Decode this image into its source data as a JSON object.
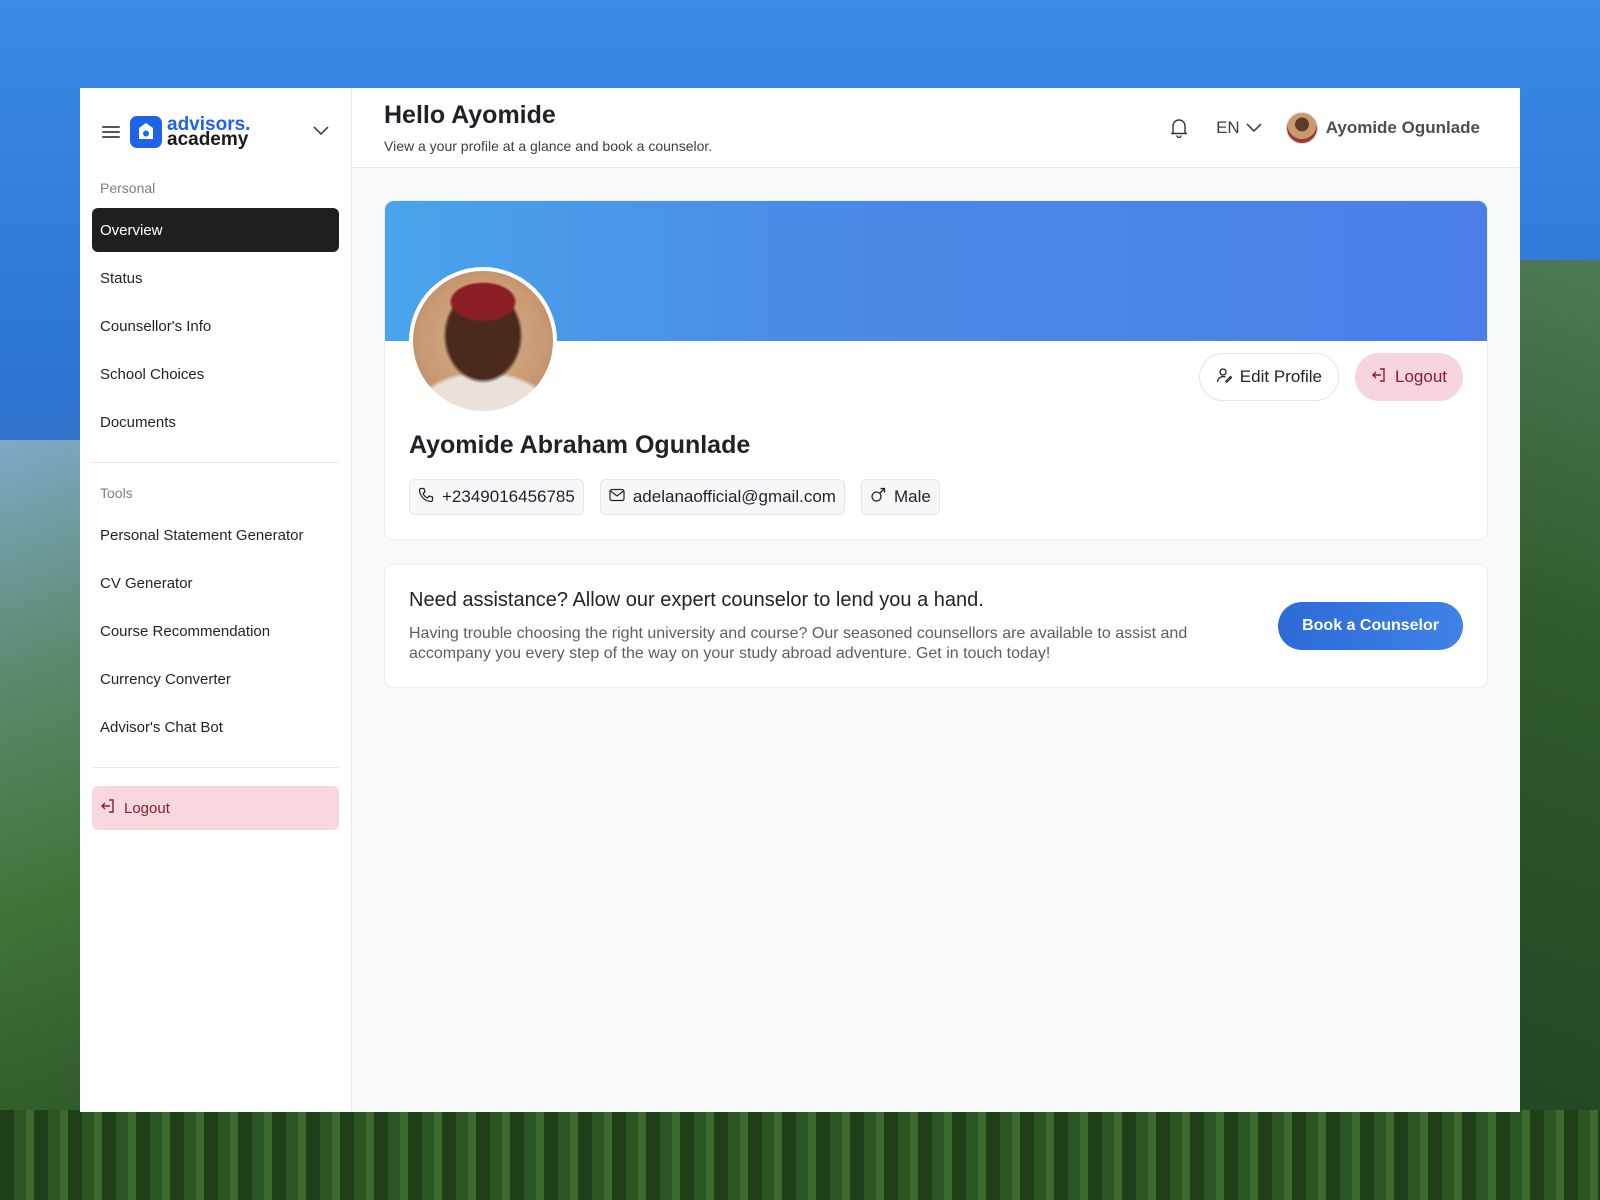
{
  "brand": {
    "name_top": "advisors.",
    "name_bottom": "academy"
  },
  "sidebar": {
    "personal_label": "Personal",
    "personal_items": [
      {
        "label": "Overview",
        "active": true
      },
      {
        "label": "Status"
      },
      {
        "label": "Counsellor's Info"
      },
      {
        "label": "School Choices"
      },
      {
        "label": "Documents"
      }
    ],
    "tools_label": "Tools",
    "tools_items": [
      {
        "label": "Personal Statement Generator"
      },
      {
        "label": "CV Generator"
      },
      {
        "label": "Course Recommendation"
      },
      {
        "label": "Currency Converter"
      },
      {
        "label": "Advisor's Chat Bot"
      }
    ],
    "logout_label": "Logout"
  },
  "header": {
    "greeting": "Hello Ayomide",
    "subtitle": "View a your profile at a glance and book a counselor.",
    "language": "EN",
    "user_name": "Ayomide Ogunlade"
  },
  "profile": {
    "full_name": "Ayomide Abraham Ogunlade",
    "phone": "+2349016456785",
    "email": "adelanaofficial@gmail.com",
    "gender": "Male",
    "edit_label": "Edit Profile",
    "logout_label": "Logout"
  },
  "assist": {
    "title": "Need assistance? Allow our expert counselor to lend you a hand.",
    "body": "Having trouble choosing the right university and course? Our seasoned counsellors are available to assist and accompany you every step of the way on your study abroad adventure. Get in touch today!",
    "cta": "Book a Counselor"
  },
  "colors": {
    "brand_blue": "#1f63e6",
    "active_nav": "#1f1f1f",
    "logout_bg": "#f8d7de",
    "logout_text": "#8b1d2c",
    "banner": "#4b7ee8",
    "cta_blue": "#2d6ad6"
  }
}
